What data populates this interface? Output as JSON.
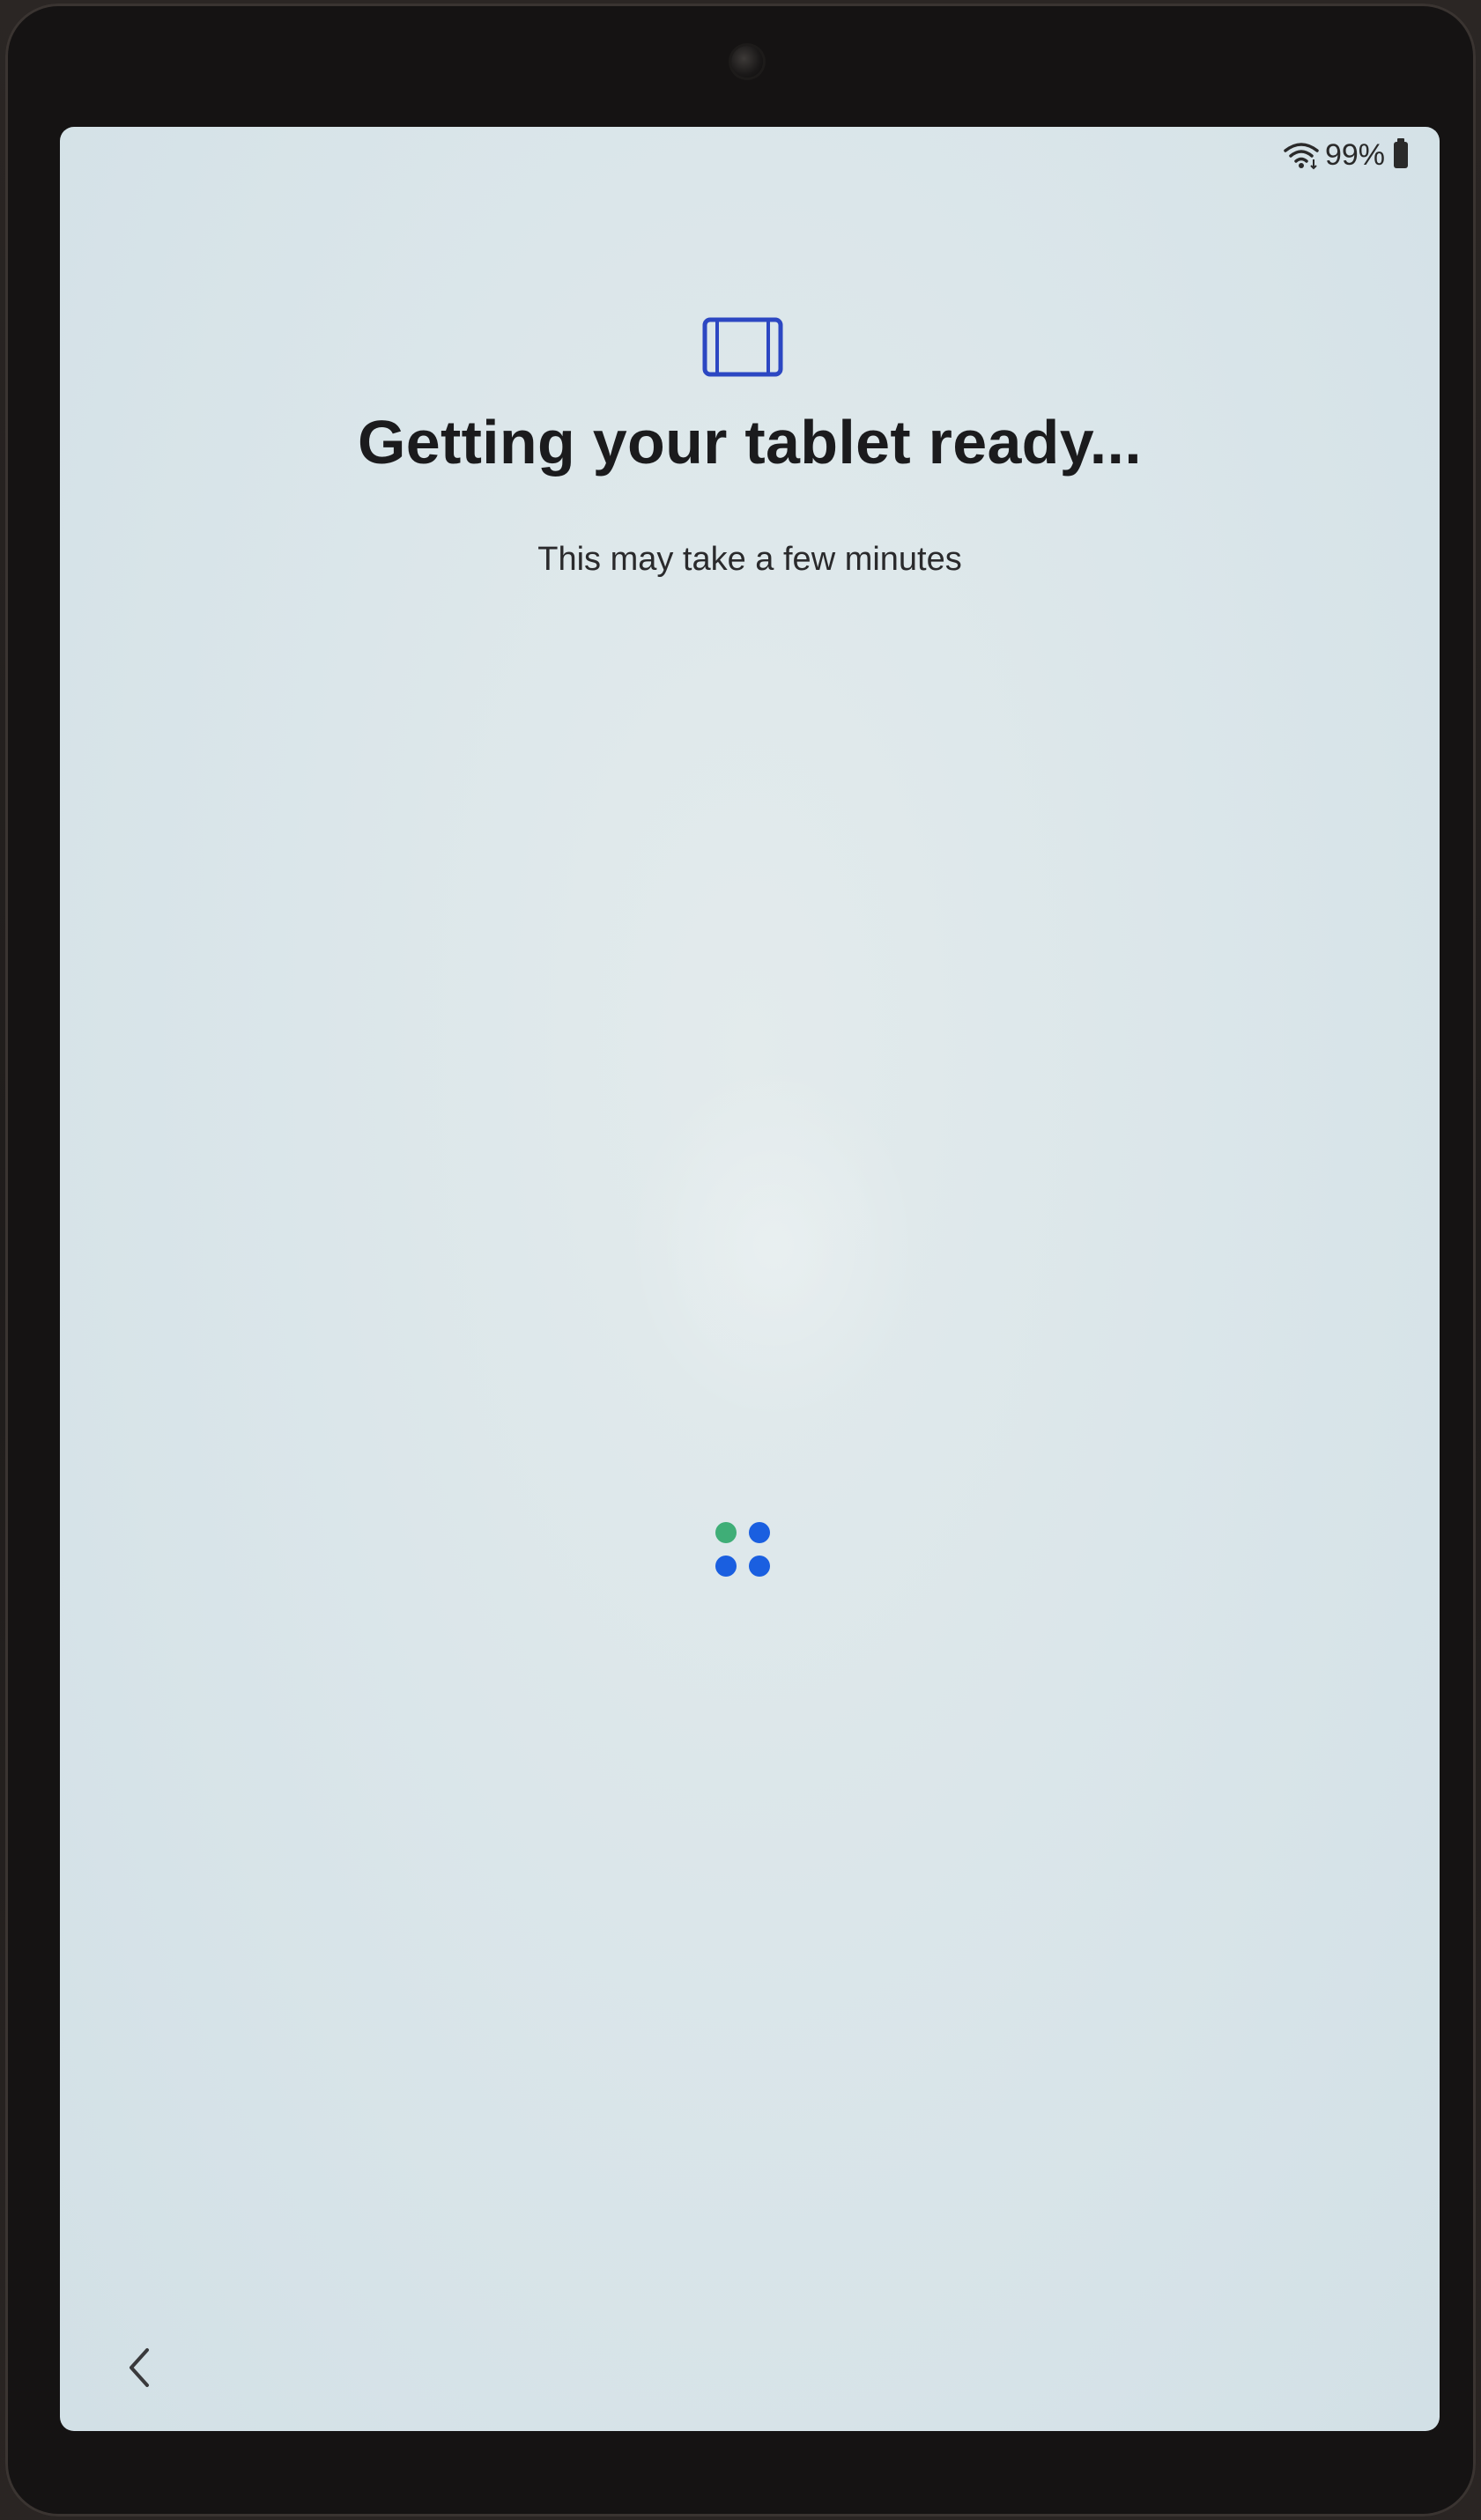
{
  "status_bar": {
    "battery_percent": "99%",
    "icons": [
      "wifi-icon",
      "battery-icon"
    ]
  },
  "setup": {
    "icon": "tablet-icon",
    "title": "Getting your tablet ready...",
    "subtitle": "This may take a few minutes"
  },
  "loading_indicator": {
    "icon": "loading-dots-icon",
    "colors": {
      "top_left": "#3fae77",
      "others": "#1a5fe0"
    }
  },
  "navigation": {
    "back_icon": "chevron-left-icon"
  },
  "colors": {
    "accent": "#2c47c2",
    "screen_background": "#dbe6ea",
    "text_primary": "#1b1b1d"
  }
}
